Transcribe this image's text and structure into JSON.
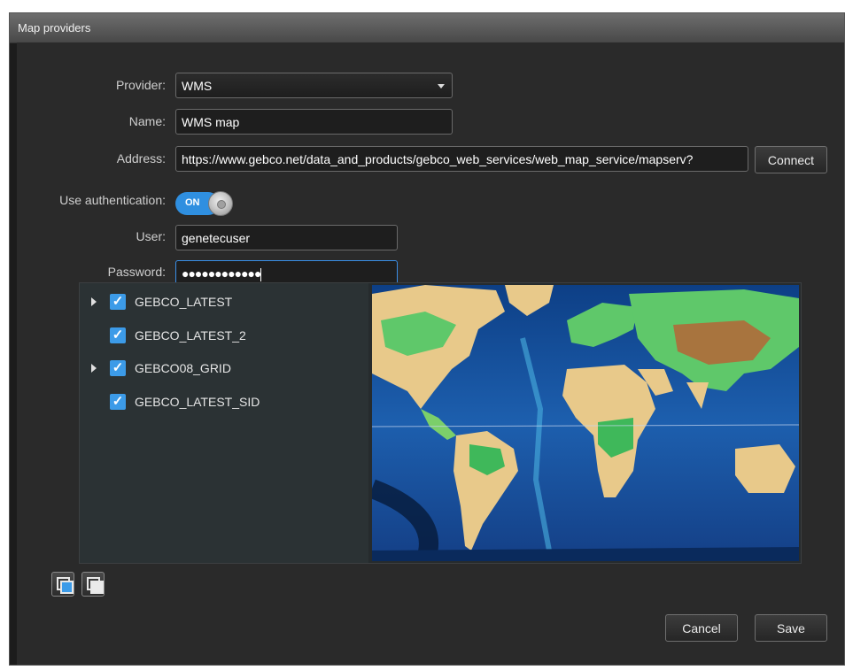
{
  "window": {
    "title": "Map providers"
  },
  "form": {
    "provider_label": "Provider:",
    "provider_value": "WMS",
    "name_label": "Name:",
    "name_value": "WMS map",
    "address_label": "Address:",
    "address_value": "https://www.gebco.net/data_and_products/gebco_web_services/web_map_service/mapserv?",
    "connect_label": "Connect",
    "auth_label": "Use authentication:",
    "auth_toggle": "ON",
    "user_label": "User:",
    "user_value": "genetecuser",
    "password_label": "Password:",
    "password_value": "●●●●●●●●●●●●"
  },
  "layers": [
    {
      "label": "GEBCO_LATEST",
      "expandable": true,
      "checked": true
    },
    {
      "label": "GEBCO_LATEST_2",
      "expandable": false,
      "checked": true
    },
    {
      "label": "GEBCO08_GRID",
      "expandable": true,
      "checked": true
    },
    {
      "label": "GEBCO_LATEST_SID",
      "expandable": false,
      "checked": true
    }
  ],
  "footer": {
    "cancel_label": "Cancel",
    "save_label": "Save"
  },
  "colors": {
    "accent": "#3c9be8",
    "background": "#2a2a2a"
  },
  "icons": {
    "select_all": "select-all-icon",
    "deselect_all": "deselect-all-icon",
    "checkbox": "check-icon",
    "expand": "expand-arrow-icon"
  }
}
